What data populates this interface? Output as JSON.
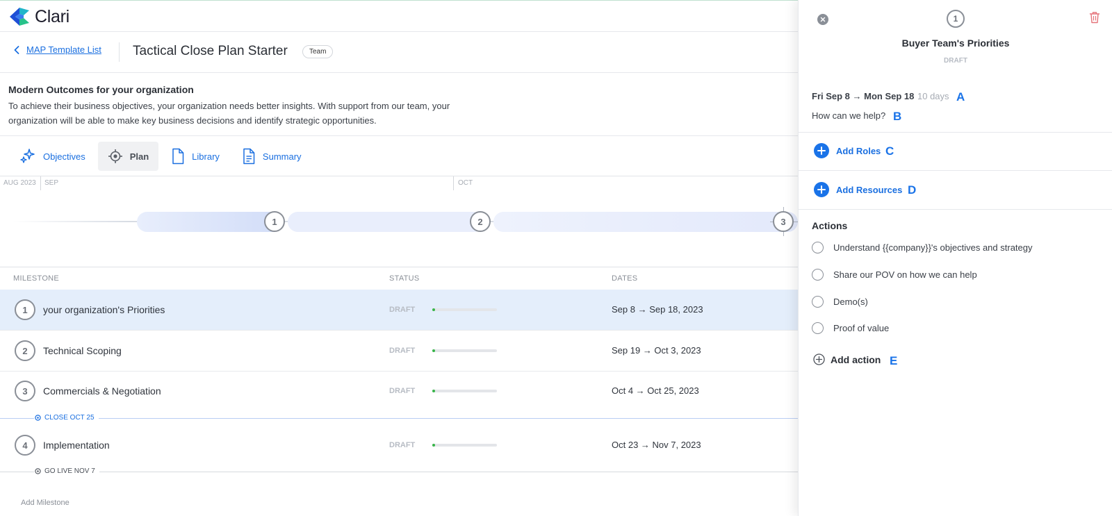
{
  "brand": {
    "name": "Clari"
  },
  "header": {
    "back_label": "MAP Template List",
    "title": "Tactical Close Plan Starter",
    "badge": "Team"
  },
  "description": {
    "title": "Modern Outcomes for your organization",
    "body": "To achieve their business objectives, your organization needs better insights. With support from our team, your organization will be able to make key business decisions and identify strategic opportunities."
  },
  "tabs": [
    {
      "label": "Objectives",
      "icon": "sparkle-icon",
      "active": false
    },
    {
      "label": "Plan",
      "icon": "target-icon",
      "active": true
    },
    {
      "label": "Library",
      "icon": "document-icon",
      "active": false
    },
    {
      "label": "Summary",
      "icon": "summary-document-icon",
      "active": false
    }
  ],
  "timeline": {
    "months": [
      "AUG 2023",
      "SEP",
      "OCT"
    ],
    "nodes": [
      "1",
      "2",
      "3"
    ]
  },
  "table": {
    "headers": {
      "milestone": "MILESTONE",
      "status": "STATUS",
      "dates": "DATES"
    },
    "rows": [
      {
        "num": "1",
        "name": "your organization's Priorities",
        "status": "DRAFT",
        "progress": 0.03,
        "dates": "Sep 8 → Sep 18, 2023"
      },
      {
        "num": "2",
        "name": "Technical Scoping",
        "status": "DRAFT",
        "progress": 0.03,
        "dates": "Sep 19 → Oct 3, 2023"
      },
      {
        "num": "3",
        "name": "Commercials & Negotiation",
        "status": "DRAFT",
        "progress": 0.03,
        "dates": "Oct 4 → Oct 25, 2023"
      },
      {
        "num": "4",
        "name": "Implementation",
        "status": "DRAFT",
        "progress": 0.03,
        "dates": "Oct 23 → Nov 7, 2023"
      }
    ],
    "markers": {
      "close": "CLOSE OCT 25",
      "go_live": "GO LIVE NOV 7"
    },
    "add_milestone": "Add Milestone"
  },
  "panel": {
    "node": "1",
    "title": "Buyer Team's Priorities",
    "status": "DRAFT",
    "dates": "Fri Sep 8 → Mon Sep 18",
    "days": "10 days",
    "help": "How can we help?",
    "add_roles": "Add Roles",
    "add_resources": "Add Resources",
    "actions_title": "Actions",
    "actions": [
      "Understand {{company}}'s objectives and strategy",
      "Share our POV on how we can help",
      "Demo(s)",
      "Proof of value"
    ],
    "add_action": "Add action",
    "letters": {
      "a": "A",
      "b": "B",
      "c": "C",
      "d": "D",
      "e": "E"
    }
  },
  "colors": {
    "accent": "#1a73e8",
    "link": "#1a6fe0",
    "progress": "#39b54a",
    "selected_row": "#e4eefb",
    "danger": "#e5737a"
  }
}
